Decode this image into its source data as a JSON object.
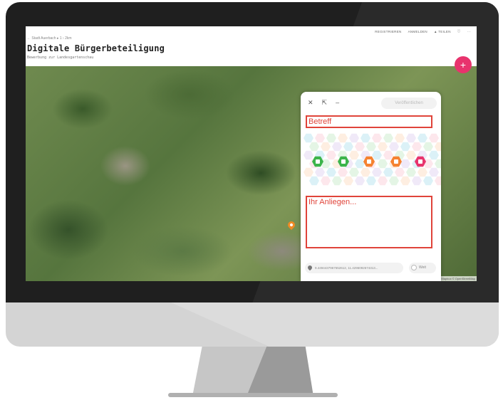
{
  "breadcrumb": "← Stadt Auerbach  ▸ 1 ›  2km",
  "page_title": "Digitale Bürgerbeteiligung",
  "page_subtitle": "Bewerbung zur Landesgartenschau",
  "menu": [
    "REGISTRIEREN",
    "ANMELDEN",
    "TEILEN"
  ],
  "toolbar": {
    "close": "✕",
    "expand": "⇱",
    "minimize": "–",
    "publish_label": "Veröffentlichen"
  },
  "form": {
    "subject_placeholder": "Betreff",
    "concern_placeholder": "Ihr Anliegen..."
  },
  "categories": [
    {
      "icon": "document-icon",
      "color": "#3cb44b"
    },
    {
      "icon": "camera-icon",
      "color": "#3cb44b"
    },
    {
      "icon": "link-icon",
      "color": "#f58231"
    },
    {
      "icon": "folder-icon",
      "color": "#f58231"
    },
    {
      "icon": "more-icon",
      "color": "#e8336d"
    }
  ],
  "location": {
    "coords": "9.4494437967652612, 11.4296092674313..."
  },
  "toggle_label": "Weit",
  "map": {
    "add_button": "+",
    "zoom_in": "+",
    "zoom_out": "–",
    "attribution": "© Mapbox © OpenStreetMap"
  },
  "colors": {
    "accent": "#e8336d",
    "error_outline": "#e0443a",
    "pin": "#f08a24"
  }
}
